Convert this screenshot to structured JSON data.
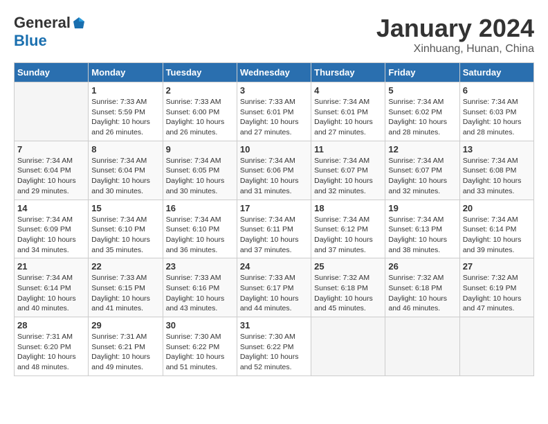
{
  "logo": {
    "general": "General",
    "blue": "Blue"
  },
  "title": "January 2024",
  "subtitle": "Xinhuang, Hunan, China",
  "days_of_week": [
    "Sunday",
    "Monday",
    "Tuesday",
    "Wednesday",
    "Thursday",
    "Friday",
    "Saturday"
  ],
  "weeks": [
    [
      {
        "day": "",
        "info": ""
      },
      {
        "day": "1",
        "info": "Sunrise: 7:33 AM\nSunset: 5:59 PM\nDaylight: 10 hours and 26 minutes."
      },
      {
        "day": "2",
        "info": "Sunrise: 7:33 AM\nSunset: 6:00 PM\nDaylight: 10 hours and 26 minutes."
      },
      {
        "day": "3",
        "info": "Sunrise: 7:33 AM\nSunset: 6:01 PM\nDaylight: 10 hours and 27 minutes."
      },
      {
        "day": "4",
        "info": "Sunrise: 7:34 AM\nSunset: 6:01 PM\nDaylight: 10 hours and 27 minutes."
      },
      {
        "day": "5",
        "info": "Sunrise: 7:34 AM\nSunset: 6:02 PM\nDaylight: 10 hours and 28 minutes."
      },
      {
        "day": "6",
        "info": "Sunrise: 7:34 AM\nSunset: 6:03 PM\nDaylight: 10 hours and 28 minutes."
      }
    ],
    [
      {
        "day": "7",
        "info": "Sunrise: 7:34 AM\nSunset: 6:04 PM\nDaylight: 10 hours and 29 minutes."
      },
      {
        "day": "8",
        "info": "Sunrise: 7:34 AM\nSunset: 6:04 PM\nDaylight: 10 hours and 30 minutes."
      },
      {
        "day": "9",
        "info": "Sunrise: 7:34 AM\nSunset: 6:05 PM\nDaylight: 10 hours and 30 minutes."
      },
      {
        "day": "10",
        "info": "Sunrise: 7:34 AM\nSunset: 6:06 PM\nDaylight: 10 hours and 31 minutes."
      },
      {
        "day": "11",
        "info": "Sunrise: 7:34 AM\nSunset: 6:07 PM\nDaylight: 10 hours and 32 minutes."
      },
      {
        "day": "12",
        "info": "Sunrise: 7:34 AM\nSunset: 6:07 PM\nDaylight: 10 hours and 32 minutes."
      },
      {
        "day": "13",
        "info": "Sunrise: 7:34 AM\nSunset: 6:08 PM\nDaylight: 10 hours and 33 minutes."
      }
    ],
    [
      {
        "day": "14",
        "info": "Sunrise: 7:34 AM\nSunset: 6:09 PM\nDaylight: 10 hours and 34 minutes."
      },
      {
        "day": "15",
        "info": "Sunrise: 7:34 AM\nSunset: 6:10 PM\nDaylight: 10 hours and 35 minutes."
      },
      {
        "day": "16",
        "info": "Sunrise: 7:34 AM\nSunset: 6:10 PM\nDaylight: 10 hours and 36 minutes."
      },
      {
        "day": "17",
        "info": "Sunrise: 7:34 AM\nSunset: 6:11 PM\nDaylight: 10 hours and 37 minutes."
      },
      {
        "day": "18",
        "info": "Sunrise: 7:34 AM\nSunset: 6:12 PM\nDaylight: 10 hours and 37 minutes."
      },
      {
        "day": "19",
        "info": "Sunrise: 7:34 AM\nSunset: 6:13 PM\nDaylight: 10 hours and 38 minutes."
      },
      {
        "day": "20",
        "info": "Sunrise: 7:34 AM\nSunset: 6:14 PM\nDaylight: 10 hours and 39 minutes."
      }
    ],
    [
      {
        "day": "21",
        "info": "Sunrise: 7:34 AM\nSunset: 6:14 PM\nDaylight: 10 hours and 40 minutes."
      },
      {
        "day": "22",
        "info": "Sunrise: 7:33 AM\nSunset: 6:15 PM\nDaylight: 10 hours and 41 minutes."
      },
      {
        "day": "23",
        "info": "Sunrise: 7:33 AM\nSunset: 6:16 PM\nDaylight: 10 hours and 43 minutes."
      },
      {
        "day": "24",
        "info": "Sunrise: 7:33 AM\nSunset: 6:17 PM\nDaylight: 10 hours and 44 minutes."
      },
      {
        "day": "25",
        "info": "Sunrise: 7:32 AM\nSunset: 6:18 PM\nDaylight: 10 hours and 45 minutes."
      },
      {
        "day": "26",
        "info": "Sunrise: 7:32 AM\nSunset: 6:18 PM\nDaylight: 10 hours and 46 minutes."
      },
      {
        "day": "27",
        "info": "Sunrise: 7:32 AM\nSunset: 6:19 PM\nDaylight: 10 hours and 47 minutes."
      }
    ],
    [
      {
        "day": "28",
        "info": "Sunrise: 7:31 AM\nSunset: 6:20 PM\nDaylight: 10 hours and 48 minutes."
      },
      {
        "day": "29",
        "info": "Sunrise: 7:31 AM\nSunset: 6:21 PM\nDaylight: 10 hours and 49 minutes."
      },
      {
        "day": "30",
        "info": "Sunrise: 7:30 AM\nSunset: 6:22 PM\nDaylight: 10 hours and 51 minutes."
      },
      {
        "day": "31",
        "info": "Sunrise: 7:30 AM\nSunset: 6:22 PM\nDaylight: 10 hours and 52 minutes."
      },
      {
        "day": "",
        "info": ""
      },
      {
        "day": "",
        "info": ""
      },
      {
        "day": "",
        "info": ""
      }
    ]
  ]
}
